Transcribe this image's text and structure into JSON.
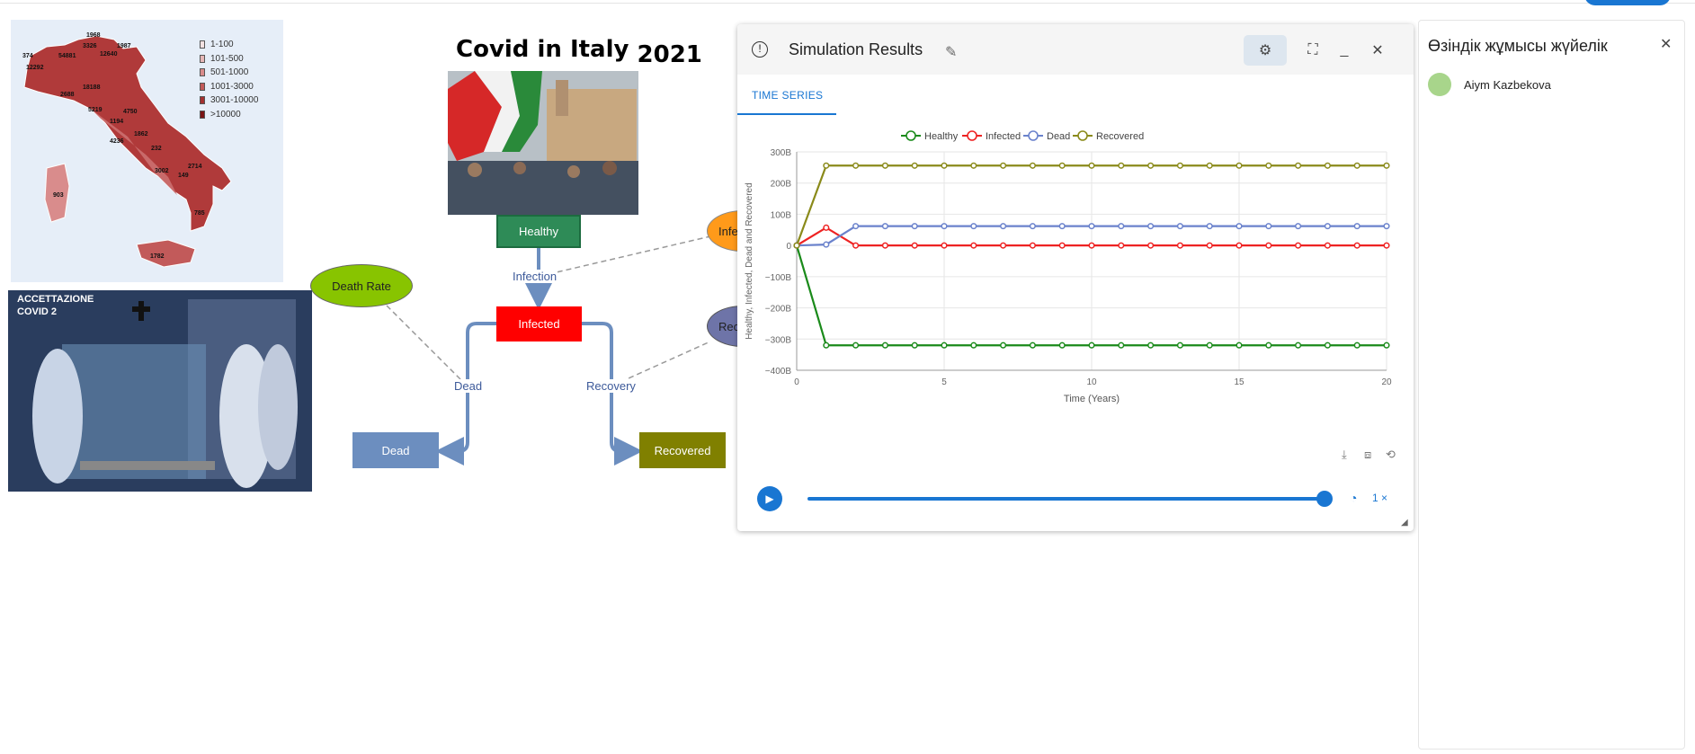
{
  "canvas": {
    "title": "Covid in Italy",
    "title_year": "2021",
    "map_legend": [
      "1-100",
      "101-500",
      "501-1000",
      "1001-3000",
      "3001-10000",
      ">10000"
    ],
    "map_legend_colors": [
      "#f3e2e2",
      "#e6b7b7",
      "#d98c8c",
      "#c25a5a",
      "#a33030",
      "#7a1414"
    ],
    "map_numbers": [
      "1968",
      "3326",
      "1987",
      "374",
      "54881",
      "12640",
      "12292",
      "18188",
      "2688",
      "5219",
      "4750",
      "1194",
      "1862",
      "4236",
      "232",
      "3002",
      "149",
      "2714",
      "903",
      "785",
      "1782"
    ],
    "ambulance_text": [
      "ACCETTAZIONE",
      "COVID 2"
    ],
    "nodes": {
      "healthy": "Healthy",
      "infected": "Infected",
      "dead": "Dead",
      "recovered": "Recovered"
    },
    "variables": {
      "death_rate": "Death Rate",
      "infection_rate_partial": "Infec",
      "recovery_rate_partial": "Rec"
    },
    "flows": {
      "infection": "Infection",
      "dead": "Dead",
      "recovery": "Recovery"
    }
  },
  "simulation": {
    "dialog_title": "Simulation Results",
    "info_icon": "info-icon",
    "tab": "TIME SERIES",
    "speed_label": "1 ×",
    "slider_fraction": 1.0
  },
  "chart_data": {
    "type": "line",
    "xlabel": "Time (Years)",
    "ylabel": "Healthy, Infected, Dead and Recovered",
    "xlim": [
      0,
      20
    ],
    "ylim": [
      -400,
      300
    ],
    "x_ticks": [
      "0",
      "5",
      "10",
      "15",
      "20"
    ],
    "y_ticks": [
      "300B",
      "200B",
      "100B",
      "0",
      "−100B",
      "−200B",
      "−300B",
      "−400B"
    ],
    "y_unit": "B",
    "grid": true,
    "legend_position": "top",
    "x": [
      0,
      1,
      2,
      3,
      4,
      5,
      6,
      7,
      8,
      9,
      10,
      11,
      12,
      13,
      14,
      15,
      16,
      17,
      18,
      19,
      20
    ],
    "series": [
      {
        "name": "Healthy",
        "color": "#1a8a1a",
        "values": [
          0,
          -320,
          -320,
          -320,
          -320,
          -320,
          -320,
          -320,
          -320,
          -320,
          -320,
          -320,
          -320,
          -320,
          -320,
          -320,
          -320,
          -320,
          -320,
          -320,
          -320
        ]
      },
      {
        "name": "Infected",
        "color": "#ee2222",
        "values": [
          0,
          57,
          0,
          0,
          0,
          0,
          0,
          0,
          0,
          0,
          0,
          0,
          0,
          0,
          0,
          0,
          0,
          0,
          0,
          0,
          0
        ]
      },
      {
        "name": "Dead",
        "color": "#6a82cc",
        "values": [
          0,
          3,
          62,
          62,
          62,
          62,
          62,
          62,
          62,
          62,
          62,
          62,
          62,
          62,
          62,
          62,
          62,
          62,
          62,
          62,
          62
        ]
      },
      {
        "name": "Recovered",
        "color": "#8a8a1a",
        "values": [
          0,
          256,
          256,
          256,
          256,
          256,
          256,
          256,
          256,
          256,
          256,
          256,
          256,
          256,
          256,
          256,
          256,
          256,
          256,
          256,
          256
        ]
      }
    ]
  },
  "side_panel": {
    "title": "Өзіндік жұмысы жүйелік",
    "user_name": "Aiym Kazbekova"
  }
}
